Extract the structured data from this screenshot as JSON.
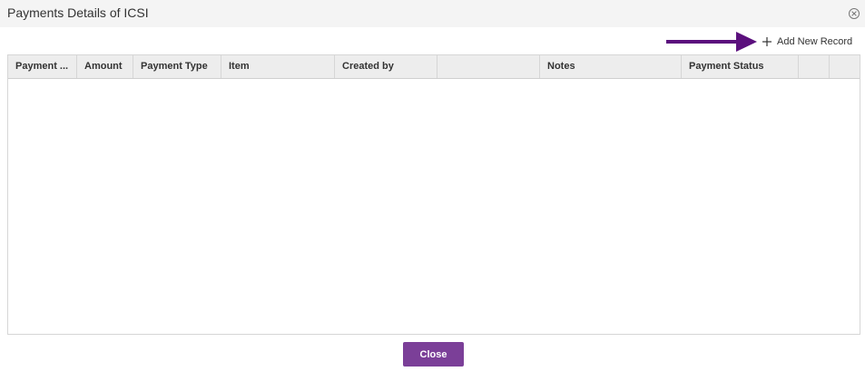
{
  "dialog": {
    "title": "Payments Details of ICSI",
    "close_icon": "close-circle-icon"
  },
  "toolbar": {
    "add_label": "Add New Record",
    "add_icon": "plus-icon",
    "annotation_arrow_color": "#5b0f7d"
  },
  "grid": {
    "columns": [
      "Payment ...",
      "Amount",
      "Payment Type",
      "Item",
      "Created by",
      "",
      "Notes",
      "Payment Status",
      "",
      ""
    ],
    "rows": []
  },
  "footer": {
    "close_label": "Close",
    "close_color": "#7b3f98"
  }
}
